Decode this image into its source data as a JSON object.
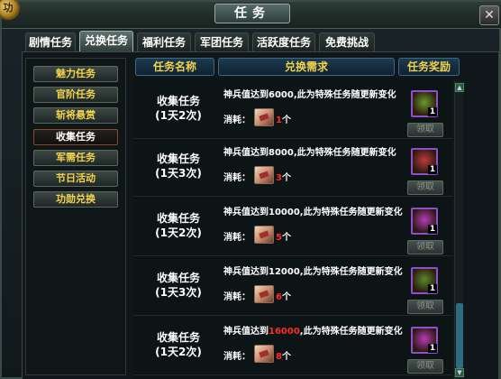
{
  "window": {
    "title": "任务",
    "emblem": "功",
    "close_icon": "close-icon"
  },
  "tabs": [
    {
      "label": "剧情任务",
      "active": false
    },
    {
      "label": "兑换任务",
      "active": true
    },
    {
      "label": "福利任务",
      "active": false
    },
    {
      "label": "军团任务",
      "active": false
    },
    {
      "label": "活跃度任务",
      "active": false
    },
    {
      "label": "免费挑战",
      "active": false
    }
  ],
  "sidebar": {
    "items": [
      {
        "label": "魅力任务",
        "active": false
      },
      {
        "label": "官阶任务",
        "active": false
      },
      {
        "label": "斩将悬赏",
        "active": false
      },
      {
        "label": "收集任务",
        "active": true
      },
      {
        "label": "军需任务",
        "active": false
      },
      {
        "label": "节日活动",
        "active": false
      },
      {
        "label": "功勋兑换",
        "active": false
      }
    ]
  },
  "table": {
    "headers": {
      "name": "任务名称",
      "requirement": "兑换需求",
      "reward": "任务奖励"
    }
  },
  "tasks": [
    {
      "name": "收集任务",
      "limit": "(1天2次)",
      "desc_prefix": "神兵值达到",
      "desc_value": "6000",
      "desc_suffix": ",此为特殊任务随更新变化",
      "value_red": false,
      "consume_label": "消耗：",
      "consume_num": "1",
      "consume_unit": "个",
      "reward_qty": "1",
      "reward_color": "#6a9a2a",
      "claim_label": "领取"
    },
    {
      "name": "收集任务",
      "limit": "(1天3次)",
      "desc_prefix": "神兵值达到",
      "desc_value": "8000",
      "desc_suffix": ",此为特殊任务随更新变化",
      "value_red": false,
      "consume_label": "消耗：",
      "consume_num": "3",
      "consume_unit": "个",
      "reward_qty": "1",
      "reward_color": "#c03a3a",
      "claim_label": "领取"
    },
    {
      "name": "收集任务",
      "limit": "(1天2次)",
      "desc_prefix": "神兵值达到",
      "desc_value": "10000",
      "desc_suffix": ",此为特殊任务随更新变化",
      "value_red": false,
      "consume_label": "消耗：",
      "consume_num": "5",
      "consume_unit": "个",
      "reward_qty": "1",
      "reward_color": "#b83ab8",
      "claim_label": "领取"
    },
    {
      "name": "收集任务",
      "limit": "(1天3次)",
      "desc_prefix": "神兵值达到",
      "desc_value": "12000",
      "desc_suffix": ",此为特殊任务随更新变化",
      "value_red": false,
      "consume_label": "消耗：",
      "consume_num": "6",
      "consume_unit": "个",
      "reward_qty": "1",
      "reward_color": "#5a8a2a",
      "claim_label": "领取"
    },
    {
      "name": "收集任务",
      "limit": "(1天2次)",
      "desc_prefix": "神兵值达到",
      "desc_value": "16000",
      "desc_suffix": ",此为特殊任务随更新变化",
      "value_red": true,
      "consume_label": "消耗：",
      "consume_num": "8",
      "consume_unit": "个",
      "reward_qty": "1",
      "reward_color": "#b83ab8",
      "claim_label": "领取"
    }
  ],
  "colors": {
    "gold_text": "#f2d34a",
    "red_text": "#ff2a2a",
    "header_blue": "#1d3a4e"
  }
}
